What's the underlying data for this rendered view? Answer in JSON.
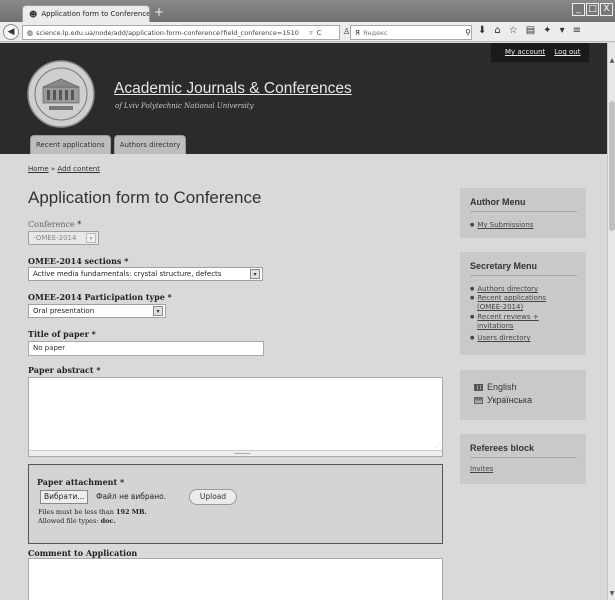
{
  "browser": {
    "tab_title": "Application form to Conference | ...",
    "new_tab": "+",
    "url": "science.lp.edu.ua/node/add/application-form-conference?field_conference=1510",
    "search_placeholder": "Яндекс",
    "win_minimize": "_",
    "win_maximize": "□",
    "win_close": "X"
  },
  "header": {
    "site_name": "Academic Journals & Conferences",
    "slogan": "of Lviv Polytechnic National University",
    "secondary": {
      "my_account": "My account",
      "logout": "Log out"
    },
    "tabs": [
      "Recent applications",
      "Authors directory"
    ]
  },
  "breadcrumb": {
    "home": "Home",
    "sep": " » ",
    "current": "Add content"
  },
  "page_title": "Application form to Conference",
  "form": {
    "conference": {
      "label": "Conference",
      "value": "-OMEE-2014"
    },
    "sections": {
      "label": "OMEE-2014 sections",
      "value": "Active media fundamentals: crystal structure, defects"
    },
    "participation": {
      "label": "OMEE-2014 Participation type",
      "value": "Oral presentation"
    },
    "title": {
      "label": "Title of paper",
      "value": "No paper"
    },
    "abstract": {
      "label": "Paper abstract"
    },
    "attachment": {
      "label": "Paper attachment",
      "browse": "Вибрати...",
      "no_file": "Файл не вибрано.",
      "upload": "Upload",
      "size_prefix": "Files must be less than ",
      "size": "192 MB.",
      "types_prefix": "Allowed file types: ",
      "types": "doc."
    },
    "comment": {
      "label": "Comment to Application"
    },
    "required_mark": "*"
  },
  "sidebar": {
    "author_menu": {
      "title": "Author Menu",
      "items": [
        "My Submissions"
      ]
    },
    "secretary_menu": {
      "title": "Secretary Menu",
      "items": [
        "Authors directory",
        "Recent applications",
        "(OMEE-2014)",
        "Recent reviews +",
        "invitations",
        "Users directory"
      ]
    },
    "languages": [
      "English",
      "Українська"
    ],
    "referees": {
      "title": "Referees block",
      "items": [
        "Invites"
      ]
    }
  }
}
